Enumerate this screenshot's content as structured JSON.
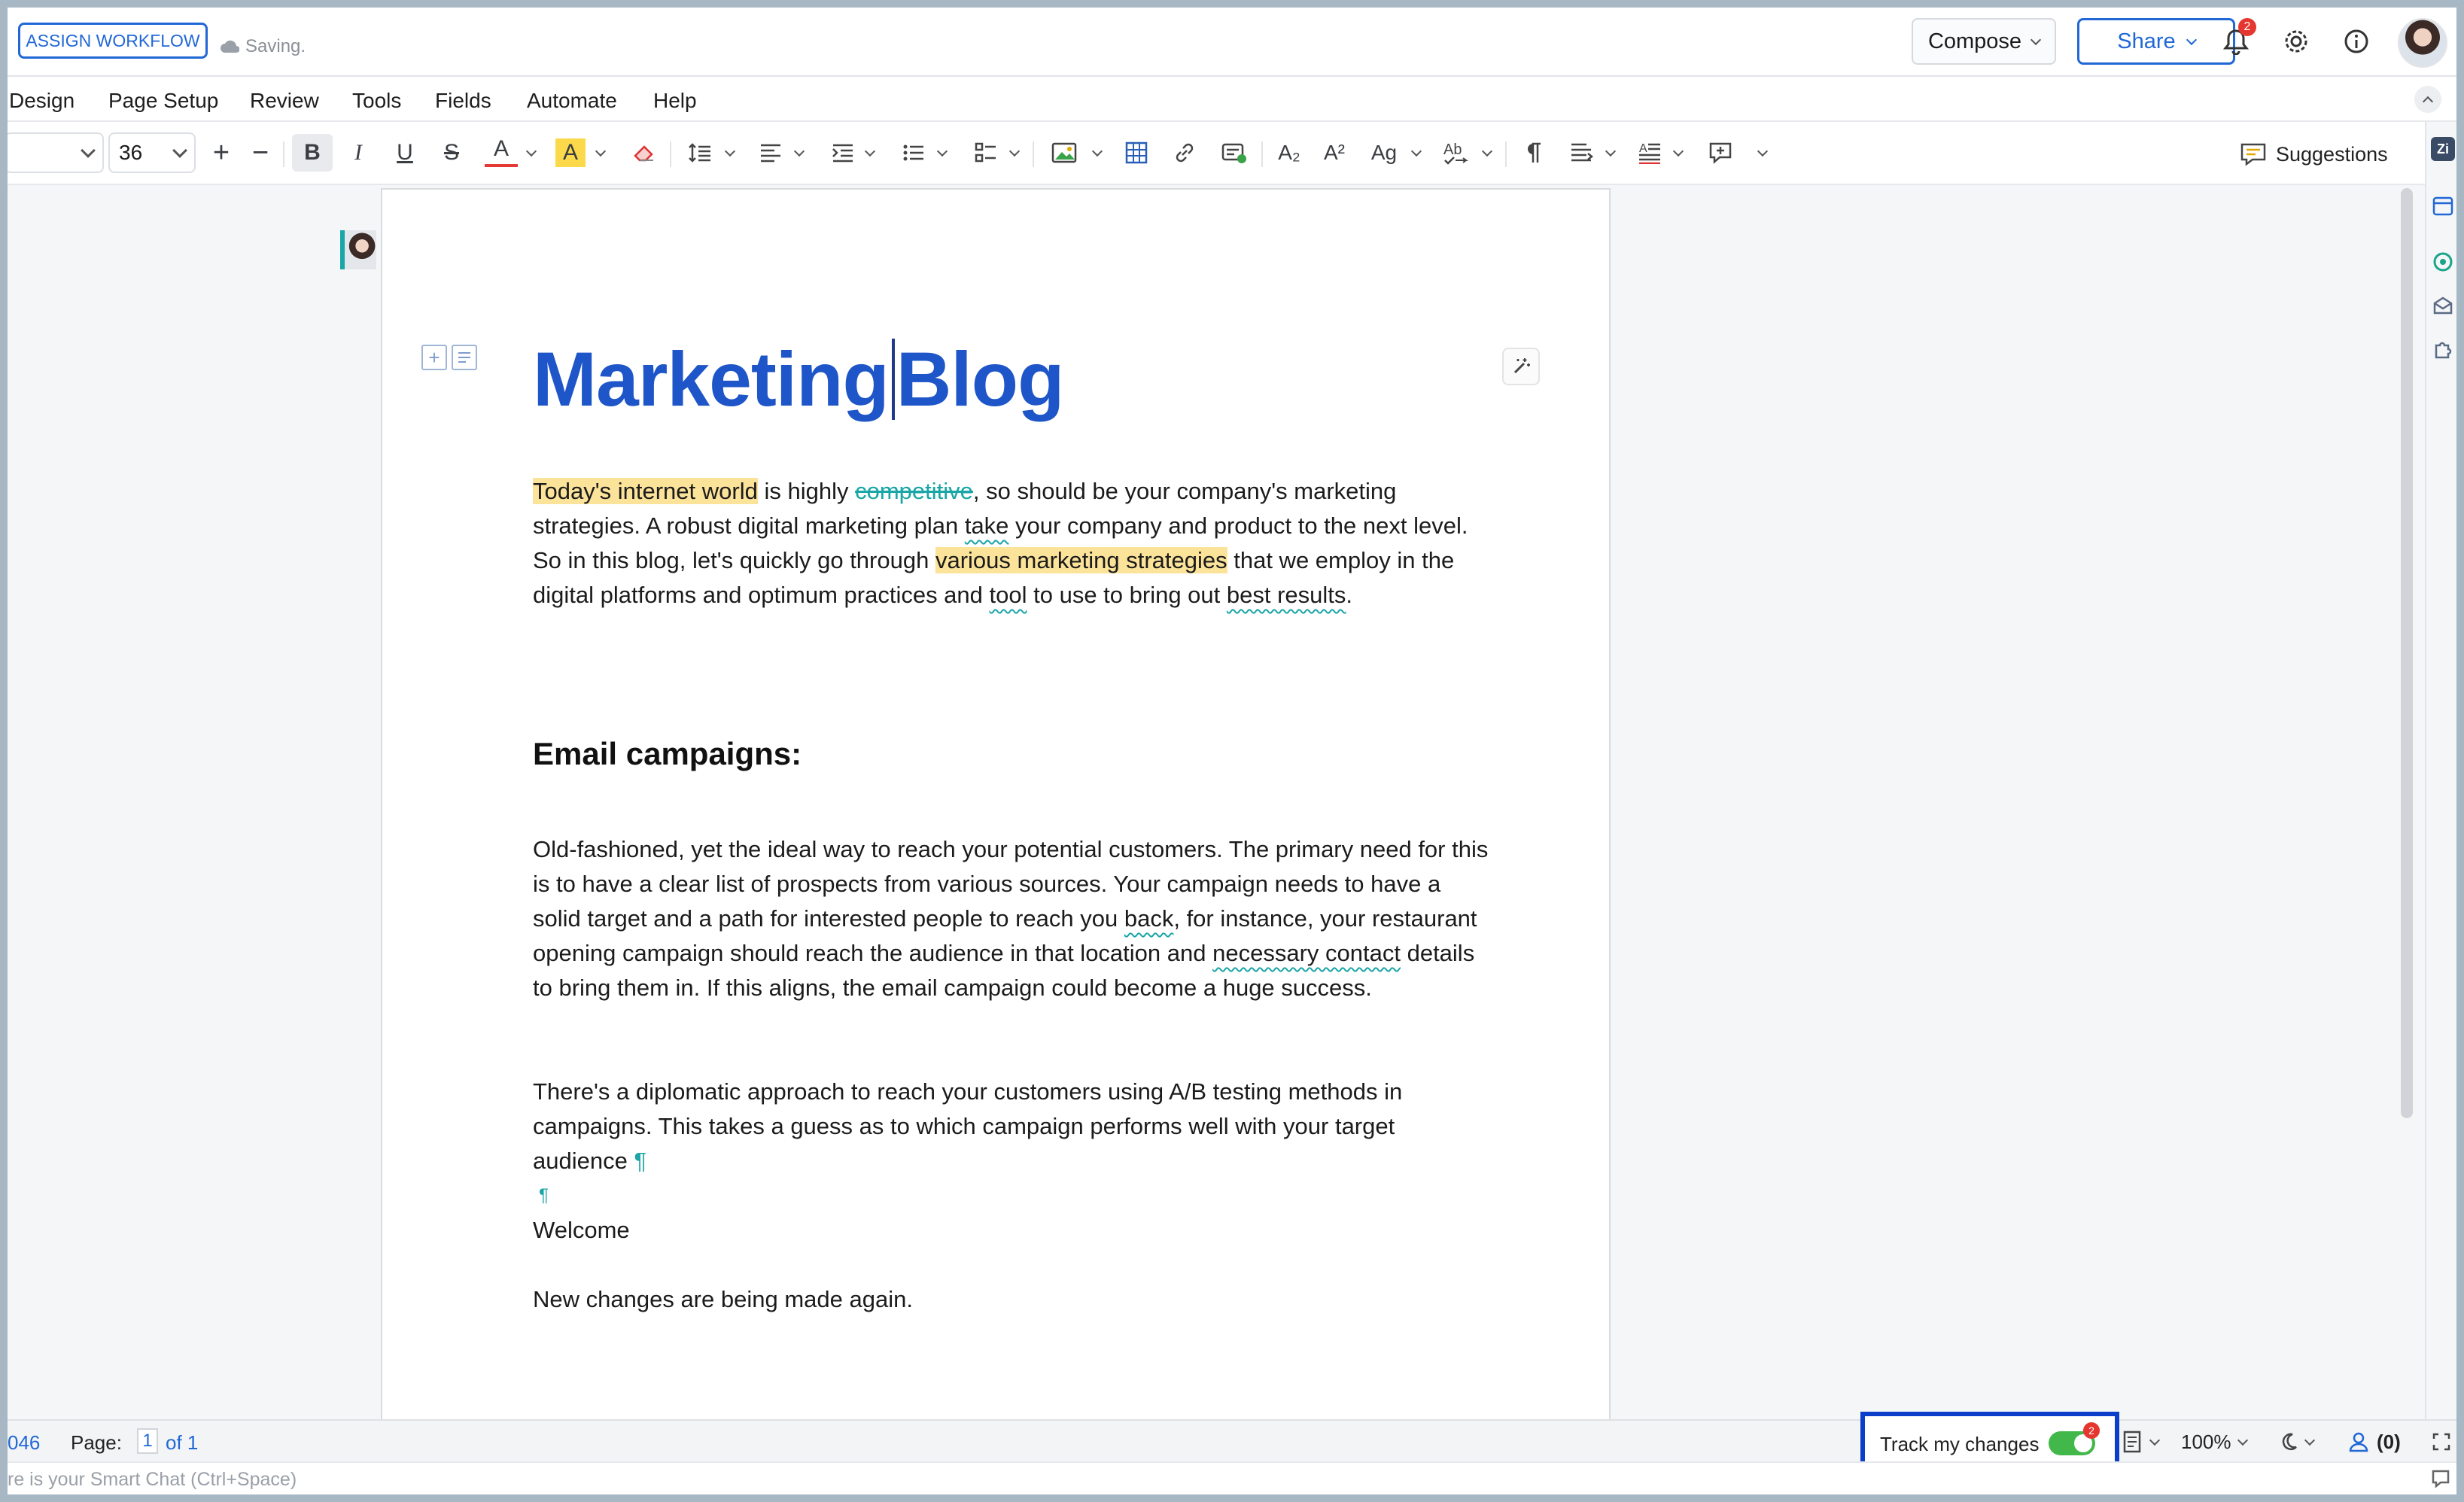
{
  "topbar": {
    "assign_workflow": "ASSIGN WORKFLOW",
    "saving_status": "Saving.",
    "compose_label": "Compose",
    "share_label": "Share",
    "notification_count": "2"
  },
  "menu": {
    "items": [
      "Design",
      "Page Setup",
      "Review",
      "Tools",
      "Fields",
      "Automate",
      "Help"
    ]
  },
  "toolbar": {
    "font_size": "36",
    "bold": "B",
    "italic": "I",
    "underline": "U",
    "strike": "S",
    "font_color": "A",
    "highlight": "A",
    "subscript": "A₂",
    "superscript": "A²",
    "change_case": "Ag",
    "suggestions_label": "Suggestions"
  },
  "document": {
    "title_part1": "Marketing",
    "title_part2": "Blog",
    "intro": {
      "hl1": "Today's internet world",
      "t1": " is highly ",
      "deleted": "competitive",
      "t2": ", so should be your company's marketing strategies. A robust digital marketing plan ",
      "sq1": "take",
      "t3": " your company and product to the next level. So in this blog, let's quickly go through ",
      "hl2": "various marketing strategies",
      "t4": " that we employ in the digital platforms and optimum practices and ",
      "sq2": "tool",
      "t5": " to use to bring out ",
      "sq3": "best results",
      "t6": "."
    },
    "heading_email": "Email campaigns:",
    "email_para": {
      "t1": "Old-fashioned, yet the ideal way to reach your potential customers. The primary need for this is to have a clear list of prospects from various sources. Your campaign needs to have a solid target and a path for interested people to reach you ",
      "sq1": "back",
      "t2": ", for instance, your restaurant opening campaign should reach the audience in that location and ",
      "sq2": "necessary contact",
      "t3": " details to bring them in. If this aligns, the email campaign could become a huge success."
    },
    "ab_para": "There's a diplomatic approach to reach your customers using A/B testing methods in campaigns. This takes a guess as to which campaign performs well with your target audience",
    "pilcrow": "¶",
    "welcome": "Welcome",
    "new_changes": "New changes are being made again."
  },
  "statusbar": {
    "word_count": "046",
    "page_label": "Page:",
    "page_current": "1",
    "page_of": "of 1",
    "track_changes_label": "Track my changes",
    "track_changes_badge": "2",
    "zoom": "100%",
    "collaborators": "(0)"
  },
  "smartchat": {
    "placeholder": "re is your Smart Chat (Ctrl+Space)"
  },
  "colors": {
    "accent": "#2168d6",
    "title": "#1e55c8",
    "highlight": "#fce39a",
    "track_change": "#1aa5a6",
    "toggle_on": "#43b84a",
    "focus_box": "#0c3fc9"
  }
}
